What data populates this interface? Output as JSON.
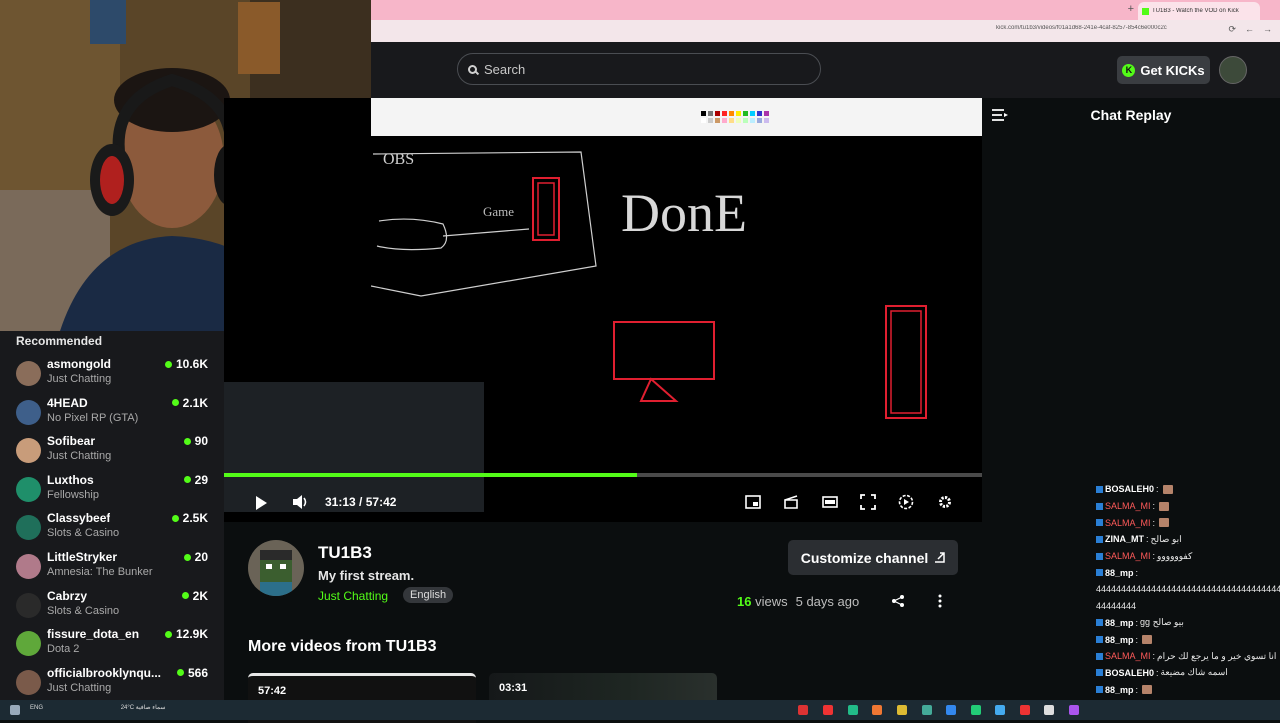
{
  "browser": {
    "tab_title": "TU1B3 - Watch the VOD on Kick",
    "new_tab": "+",
    "url": "kick.com/tu1b3/videos/f01a1d68-241e-4caf-8257-854c6e000c2c"
  },
  "header": {
    "search_placeholder": "Search",
    "get_kicks_label": "Get KICKs",
    "kicks_icon": "K"
  },
  "sidebar": {
    "title": "Recommended",
    "items": [
      {
        "name": "asmongold",
        "category": "Just Chatting",
        "viewers": "10.6K",
        "avatar_color": "#8a6d5a"
      },
      {
        "name": "4HEAD",
        "category": "No Pixel RP (GTA)",
        "viewers": "2.1K",
        "avatar_color": "#3e5f8a"
      },
      {
        "name": "Sofibear",
        "category": "Just Chatting",
        "viewers": "90",
        "avatar_color": "#c89c7a"
      },
      {
        "name": "Luxthos",
        "category": "Fellowship",
        "viewers": "29",
        "avatar_color": "#1f8f6a"
      },
      {
        "name": "Classybeef",
        "category": "Slots & Casino",
        "viewers": "2.5K",
        "avatar_color": "#1f6f5a"
      },
      {
        "name": "LittleStryker",
        "category": "Amnesia: The Bunker",
        "viewers": "20",
        "avatar_color": "#b07a8a"
      },
      {
        "name": "Cabrzy",
        "category": "Slots & Casino",
        "viewers": "2K",
        "avatar_color": "#2a2a2a"
      },
      {
        "name": "fissure_dota_en",
        "category": "Dota 2",
        "viewers": "12.9K",
        "avatar_color": "#5fa83a"
      },
      {
        "name": "officialbrooklynqu...",
        "category": "Just Chatting",
        "viewers": "566",
        "avatar_color": "#7a5a4a"
      }
    ]
  },
  "player": {
    "time_current": "31:13",
    "time_separator": "/",
    "time_total": "57:42",
    "progress": 0.545
  },
  "video": {
    "channel": "TU1B3",
    "title": "My first stream.",
    "category": "Just Chatting",
    "language": "English",
    "customize_label": "Customize channel",
    "views": "16",
    "views_label": "views",
    "age": "5 days ago",
    "more_videos_title": "More videos from TU1B3",
    "thumbs": [
      {
        "duration": "57:42"
      },
      {
        "duration": "03:31"
      }
    ]
  },
  "chat": {
    "title": "Chat Replay",
    "messages": [
      {
        "user": "BOSALEH0",
        "text": "",
        "color": "white",
        "emote": true
      },
      {
        "user": "SALMA_MI",
        "text": "",
        "color": "red",
        "emote": true
      },
      {
        "user": "SALMA_MI",
        "text": "",
        "color": "red",
        "emote": true
      },
      {
        "user": "ZINA_MT",
        "text": "ابو صالح",
        "color": "white",
        "emote": false
      },
      {
        "user": "SALMA_MI",
        "text": "كفوووووو",
        "color": "red",
        "emote": false
      },
      {
        "user": "88_mp",
        "text": "",
        "color": "white",
        "emote": false
      },
      {
        "user": "",
        "text": "444444444444444444444444444444444444444",
        "color": "white",
        "emote": false
      },
      {
        "user": "",
        "text": "44444444",
        "color": "white",
        "emote": false
      },
      {
        "user": "88_mp",
        "text": "gg بيو صالح",
        "color": "white",
        "emote": false
      },
      {
        "user": "88_mp",
        "text": "",
        "color": "white",
        "emote": true
      },
      {
        "user": "SALMA_MI",
        "text": "انا تسوي خير و ما يرجع لك حرام",
        "color": "red",
        "emote": false
      },
      {
        "user": "BOSALEH0",
        "text": "اسمه شاك مضيعة",
        "color": "white",
        "emote": false
      },
      {
        "user": "88_mp",
        "text": "",
        "color": "white",
        "emote": true
      }
    ]
  },
  "taskbar": {
    "tray_text": "ENG",
    "temp": "24°C",
    "weather": "سماء صافية"
  },
  "colors": {
    "kick_green": "#53fc18",
    "bg": "#0b0e0f",
    "panel": "#18191c"
  }
}
